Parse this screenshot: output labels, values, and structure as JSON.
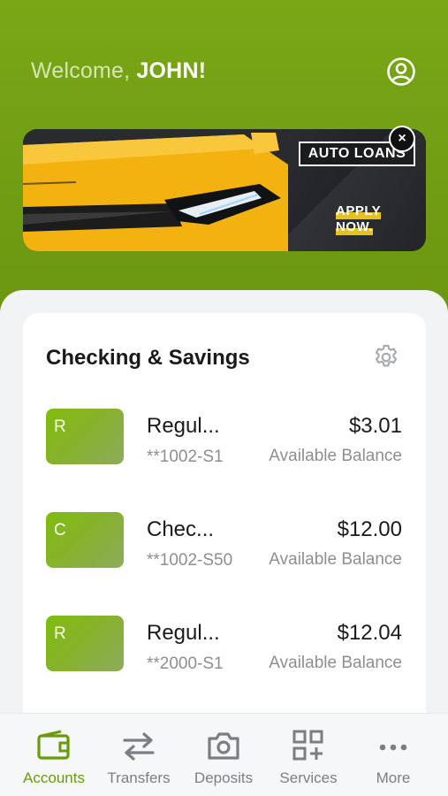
{
  "header": {
    "welcome_prefix": "Welcome,",
    "user_name": "JOHN!",
    "profile_icon": "user-circle-icon"
  },
  "banner": {
    "headline": "AUTO LOANS",
    "cta_line1": "APPLY",
    "cta_line2": "NOW.",
    "close_label": "×",
    "accent_color": "#e8c21a"
  },
  "accounts_card": {
    "title": "Checking & Savings",
    "settings_icon": "gear-icon",
    "accounts": [
      {
        "initial": "R",
        "name": "Regul...",
        "number": "**1002-S1",
        "balance": "$3.01",
        "balance_label": "Available Balance"
      },
      {
        "initial": "C",
        "name": "Chec...",
        "number": "**1002-S50",
        "balance": "$12.00",
        "balance_label": "Available Balance"
      },
      {
        "initial": "R",
        "name": "Regul...",
        "number": "**2000-S1",
        "balance": "$12.04",
        "balance_label": "Available Balance"
      }
    ]
  },
  "bottom_nav": {
    "items": [
      {
        "label": "Accounts",
        "icon": "wallet-icon",
        "active": true
      },
      {
        "label": "Transfers",
        "icon": "transfer-arrows-icon",
        "active": false
      },
      {
        "label": "Deposits",
        "icon": "camera-icon",
        "active": false
      },
      {
        "label": "Services",
        "icon": "grid-plus-icon",
        "active": false
      },
      {
        "label": "More",
        "icon": "more-dots-icon",
        "active": false
      }
    ]
  },
  "colors": {
    "brand_green": "#79a716",
    "active_nav": "#6a9b0e",
    "muted_text": "#8e8e8e"
  }
}
